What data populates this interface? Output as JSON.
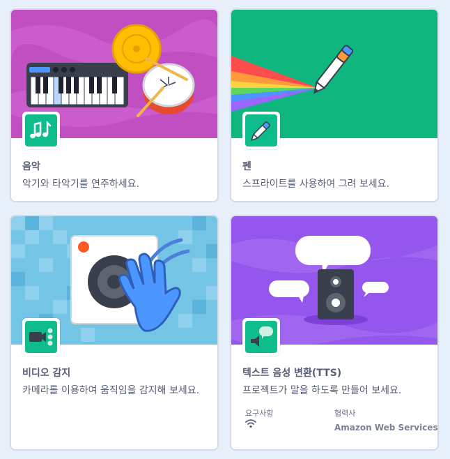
{
  "extensions": [
    {
      "id": "music",
      "title": "음악",
      "description": "악기와 타악기를 연주하세요.",
      "image_bg": "#c14fc2",
      "icon": "music-notes-icon"
    },
    {
      "id": "pen",
      "title": "펜",
      "description": "스프라이트를 사용하여 그려 보세요.",
      "image_bg": "#0fb67e",
      "icon": "pen-icon"
    },
    {
      "id": "video-sensing",
      "title": "비디오 감지",
      "description": "카메라를 이용하여 움직임을 감지해 보세요.",
      "image_bg": "#74c4e6",
      "icon": "video-camera-icon"
    },
    {
      "id": "text-to-speech",
      "title": "텍스트 음성 변환(TTS)",
      "description": "프로젝트가 말을 하도록 만들어 보세요.",
      "image_bg": "#9456ec",
      "icon": "speech-bubble-icon",
      "requirements_label": "요구사항",
      "requirements_icon": "wifi-icon",
      "collaborator_label": "협력사",
      "collaborator": "Amazon Web Services"
    }
  ],
  "colors": {
    "page_bg": "#e7effa",
    "badge_green": "#0fbd8c",
    "text": "#575e75"
  }
}
